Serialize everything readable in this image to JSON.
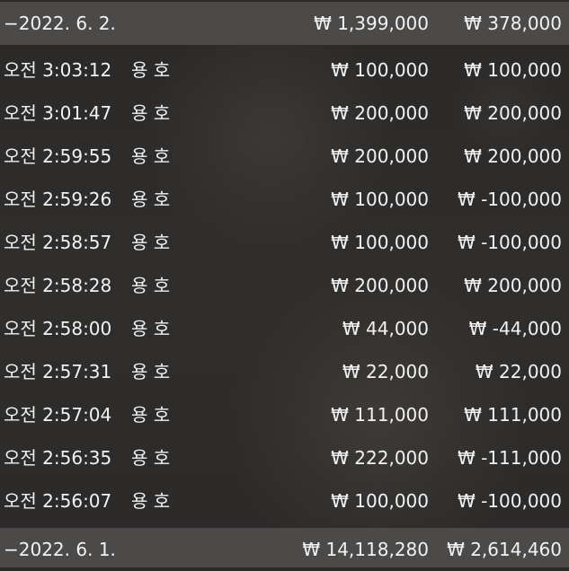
{
  "groups": [
    {
      "date": "−2022. 6. 2.",
      "amount": "₩ 1,399,000",
      "balance": "₩ 378,000"
    },
    {
      "date": "−2022. 6. 1.",
      "amount": "₩ 14,118,280",
      "balance": "₩ 2,614,460"
    }
  ],
  "transactions": [
    {
      "time": "오전 3:03:12",
      "name": "용 호",
      "amount": "₩ 100,000",
      "balance": "₩ 100,000"
    },
    {
      "time": "오전 3:01:47",
      "name": "용 호",
      "amount": "₩ 200,000",
      "balance": "₩ 200,000"
    },
    {
      "time": "오전 2:59:55",
      "name": "용 호",
      "amount": "₩ 200,000",
      "balance": "₩ 200,000"
    },
    {
      "time": "오전 2:59:26",
      "name": "용 호",
      "amount": "₩ 100,000",
      "balance": "₩ -100,000"
    },
    {
      "time": "오전 2:58:57",
      "name": "용 호",
      "amount": "₩ 100,000",
      "balance": "₩ -100,000"
    },
    {
      "time": "오전 2:58:28",
      "name": "용 호",
      "amount": "₩ 200,000",
      "balance": "₩ 200,000"
    },
    {
      "time": "오전 2:58:00",
      "name": "용 호",
      "amount": "₩ 44,000",
      "balance": "₩ -44,000"
    },
    {
      "time": "오전 2:57:31",
      "name": "용 호",
      "amount": "₩ 22,000",
      "balance": "₩ 22,000"
    },
    {
      "time": "오전 2:57:04",
      "name": "용 호",
      "amount": "₩ 111,000",
      "balance": "₩ 111,000"
    },
    {
      "time": "오전 2:56:35",
      "name": "용 호",
      "amount": "₩ 222,000",
      "balance": "₩ -111,000"
    },
    {
      "time": "오전 2:56:07",
      "name": "용 호",
      "amount": "₩ 100,000",
      "balance": "₩ -100,000"
    }
  ]
}
